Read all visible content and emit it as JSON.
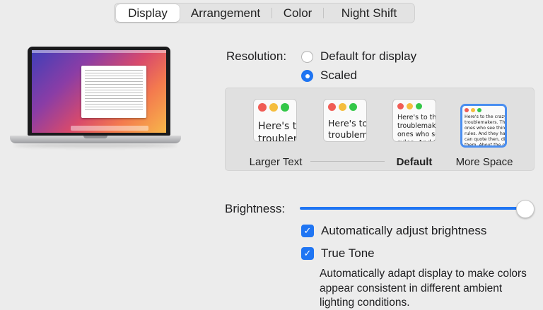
{
  "tabs": [
    {
      "label": "Display",
      "active": true
    },
    {
      "label": "Arrangement",
      "active": false
    },
    {
      "label": "Color",
      "active": false
    },
    {
      "label": "Night Shift",
      "active": false
    }
  ],
  "resolution": {
    "label": "Resolution:",
    "options": [
      {
        "label": "Default for display",
        "selected": false
      },
      {
        "label": "Scaled",
        "selected": true
      }
    ]
  },
  "scaled_options": [
    {
      "label": "Larger Text",
      "preview_text": "Here's to t\ntroublema\nones who",
      "selected": false,
      "bold": false
    },
    {
      "label": "",
      "preview_text": "Here's to t\ntroublema\nones who",
      "selected": false,
      "bold": false
    },
    {
      "label": "Default",
      "preview_text": "Here's to the cr\ntroublemakers.\nones who see t\nrules. And they",
      "selected": false,
      "bold": true
    },
    {
      "label": "More Space",
      "preview_text": "Here's to the crazy one\ntroublemakers. The rou\nones who see things dif\nrules. And they have no\ncan quote then, disagre\nthem. About the only th\nBecause they change t",
      "selected": true,
      "bold": false
    }
  ],
  "brightness": {
    "label": "Brightness:",
    "level": 1.0,
    "auto_adjust": {
      "label": "Automatically adjust brightness",
      "checked": true
    },
    "true_tone": {
      "label": "True Tone",
      "checked": true,
      "description": "Automatically adapt display to make colors appear consistent in different ambient lighting conditions."
    }
  },
  "colors": {
    "accent": "#1f75f3",
    "traffic_red": "#f05c55",
    "traffic_yellow": "#f5bd3d",
    "traffic_green": "#33c748"
  }
}
